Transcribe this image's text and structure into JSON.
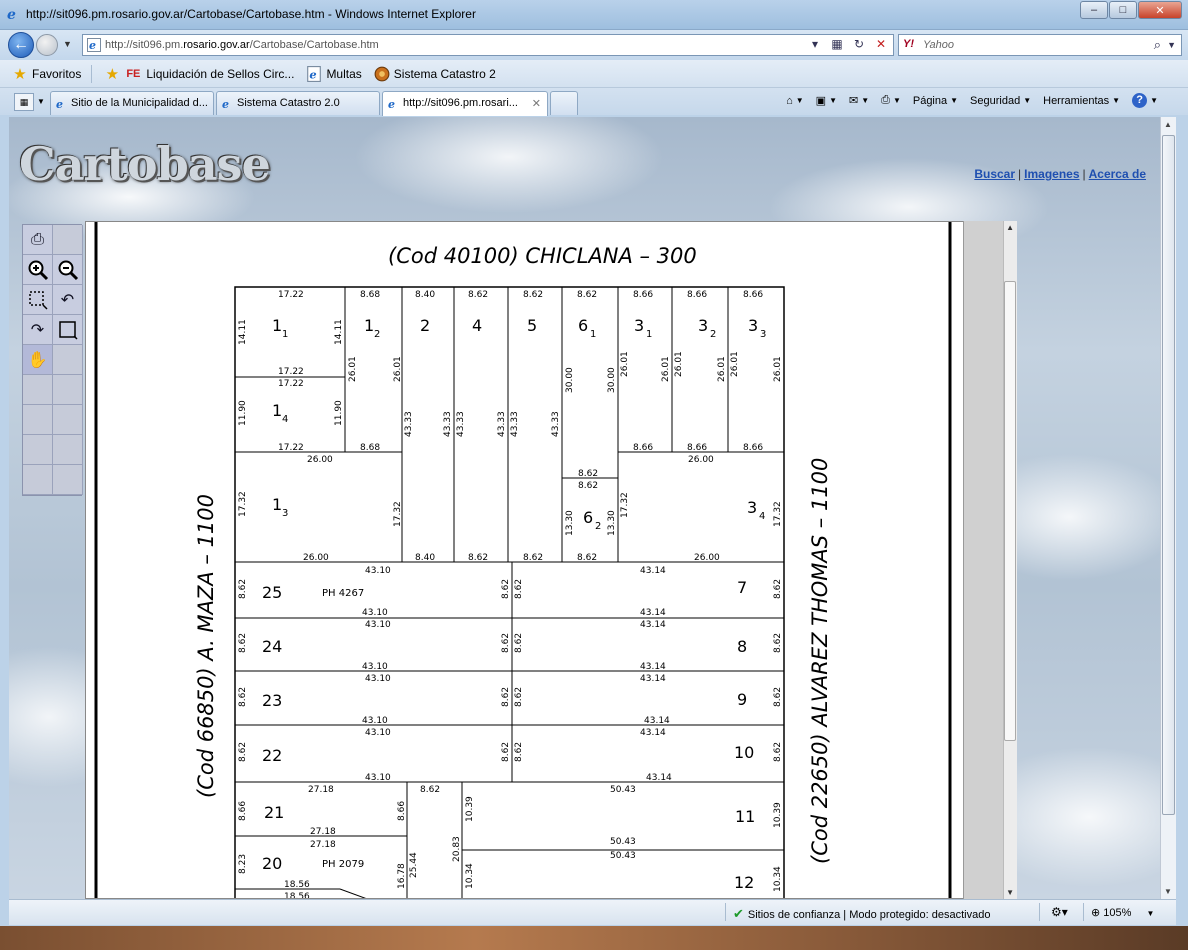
{
  "window": {
    "title": "http://sit096.pm.rosario.gov.ar/Cartobase/Cartobase.htm - Windows Internet Explorer",
    "btn_min": "–",
    "btn_max": "□",
    "btn_close": "✕"
  },
  "address": {
    "prefix": "http://sit096.pm.",
    "domain": "rosario.gov.ar",
    "path": "/Cartobase/Cartobase.htm"
  },
  "search": {
    "placeholder": "Yahoo",
    "brand": "Y!"
  },
  "favorites": {
    "label": "Favoritos",
    "items": [
      "Liquidación de Sellos Circ...",
      "Multas",
      "Sistema Catastro 2"
    ]
  },
  "tabs": [
    {
      "label": "Sitio de la Municipalidad d..."
    },
    {
      "label": "Sistema Catastro 2.0"
    },
    {
      "label": "http://sit096.pm.rosari..."
    }
  ],
  "commands": {
    "pagina": "Página",
    "seguridad": "Seguridad",
    "herramientas": "Herramientas"
  },
  "page": {
    "logo": "Cartobase",
    "links": [
      "Buscar",
      "Imagenes",
      "Acerca de"
    ],
    "link_sep": "|"
  },
  "map": {
    "streets": {
      "top": "(Cod  40100)  CHICLANA – 300",
      "left": "(Cod  66850)  A. MAZA – 1100",
      "right": "(Cod  22650)  ALVAREZ THOMAS – 1100"
    },
    "ph_labels": [
      "PH  4267",
      "PH  2079"
    ]
  },
  "status": {
    "zone": "Sitios de confianza | Modo protegido: desactivado",
    "zoom": "105%"
  }
}
